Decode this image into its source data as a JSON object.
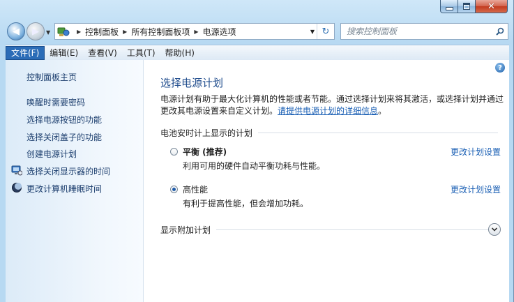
{
  "window": {
    "caption": {
      "minimize": "—",
      "maximize": "▢",
      "close": "✕"
    }
  },
  "nav": {
    "breadcrumb": [
      "控制面板",
      "所有控制面板项",
      "电源选项"
    ],
    "search_placeholder": "搜索控制面板"
  },
  "menu": [
    {
      "label": "文件(F)",
      "active": true
    },
    {
      "label": "编辑(E)",
      "active": false
    },
    {
      "label": "查看(V)",
      "active": false
    },
    {
      "label": "工具(T)",
      "active": false
    },
    {
      "label": "帮助(H)",
      "active": false
    }
  ],
  "sidebar": {
    "home": "控制面板主页",
    "links": [
      "唤醒时需要密码",
      "选择电源按钮的功能",
      "选择关闭盖子的功能",
      "创建电源计划",
      "选择关闭显示器的时间",
      "更改计算机睡眠时间"
    ]
  },
  "main": {
    "title": "选择电源计划",
    "description": "电源计划有助于最大化计算机的性能或者节能。通过选择计划来将其激活，或选择计划并通过更改其电源设置来自定义计划。",
    "description_link": "请提供电源计划的详细信息",
    "description_end": "。",
    "group_battery": "电池安时计上显示的计划",
    "plans": [
      {
        "name": "平衡 (推荐)",
        "bold": true,
        "checked": false,
        "desc": "利用可用的硬件自动平衡功耗与性能。",
        "link": "更改计划设置"
      },
      {
        "name": "高性能",
        "bold": false,
        "checked": true,
        "desc": "有利于提高性能，但会增加功耗。",
        "link": "更改计划设置"
      }
    ],
    "group_additional": "显示附加计划"
  },
  "colors": {
    "link": "#1a5fb4",
    "title": "#1e4b8c",
    "menu_active": "#2b6cb7"
  },
  "icons": {
    "back": "left-arrow-icon",
    "forward": "right-arrow-icon",
    "refresh": "refresh-icon",
    "search": "magnifier-icon",
    "help": "question-icon",
    "monitor": "monitor-icon",
    "sleep": "moon-icon",
    "expand": "chevron-down-icon"
  }
}
